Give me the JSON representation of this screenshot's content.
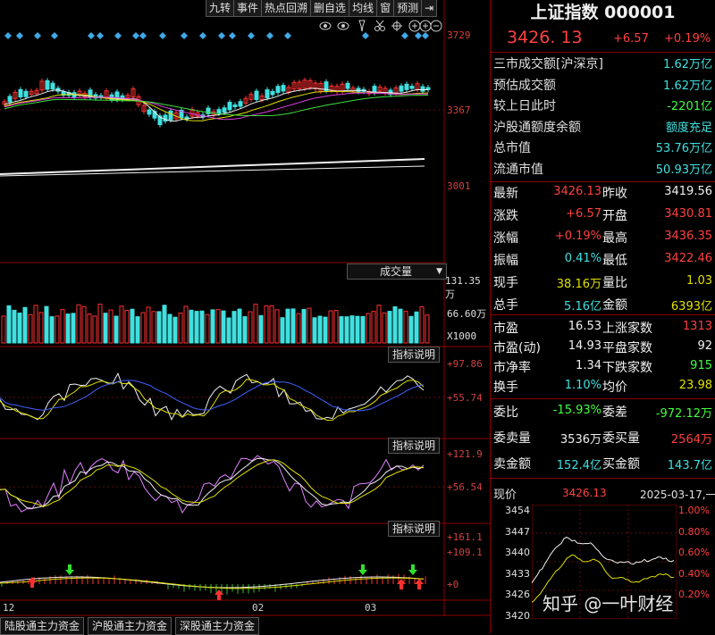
{
  "toolbar": [
    "九转",
    "事件",
    "热点回溯",
    "删自选",
    "均线",
    "窗",
    "预测"
  ],
  "toolbar_arrow": "⇥",
  "main_axis": {
    "top": "3729",
    "mid": "3367",
    "bottom": "3001"
  },
  "volume": {
    "selector": "成交量",
    "v1": "131.35万",
    "v2": "66.60万",
    "unit": "X1000"
  },
  "ind1": {
    "button": "指标说明",
    "top": "+97.86",
    "mid": "+55.74"
  },
  "ind2": {
    "button": "指标说明",
    "top": "+121.9",
    "mid": "+56.54"
  },
  "ind3": {
    "button": "指标说明",
    "top": "+161.1",
    "mid": "+109.1",
    "zero": "+0"
  },
  "x_labels": [
    "12",
    "02",
    "03"
  ],
  "bottom_tabs": [
    "陆股通主力资金",
    "沪股通主力资金",
    "深股通主力资金"
  ],
  "header": {
    "name": "上证指数",
    "code": "000001",
    "price": "3426. 13",
    "change": "+6.57",
    "pct": "+0.19%"
  },
  "info": [
    {
      "k": "三市成交额[沪深京]",
      "v": "1.62万亿",
      "c": "cyan"
    },
    {
      "k": "预估成交额",
      "v": "1.62万亿",
      "c": "cyan"
    },
    {
      "k": "较上日此时",
      "v": "-2201亿",
      "c": "green"
    },
    {
      "k": "沪股通额度余额",
      "v": "额度充足",
      "c": "cyan"
    },
    {
      "k": "总市值",
      "v": "53.76万亿",
      "c": "cyan"
    },
    {
      "k": "流通市值",
      "v": "50.93万亿",
      "c": "cyan"
    }
  ],
  "quotes": [
    {
      "k1": "最新",
      "v1": "3426.13",
      "c1": "red",
      "k2": "昨收",
      "v2": "3419.56",
      "c2": "white"
    },
    {
      "k1": "涨跌",
      "v1": "+6.57",
      "c1": "red",
      "k2": "开盘",
      "v2": "3430.81",
      "c2": "red"
    },
    {
      "k1": "涨幅",
      "v1": "+0.19%",
      "c1": "red",
      "k2": "最高",
      "v2": "3436.35",
      "c2": "red"
    },
    {
      "k1": "振幅",
      "v1": "0.41%",
      "c1": "cyan",
      "k2": "最低",
      "v2": "3422.46",
      "c2": "red"
    },
    {
      "k1": "现手",
      "v1": "38.16万",
      "c1": "yellow",
      "k2": "量比",
      "v2": "1.03",
      "c2": "yellow"
    },
    {
      "k1": "总手",
      "v1": "5.16亿",
      "c1": "cyan",
      "k2": "金额",
      "v2": "6393亿",
      "c2": "yellow"
    }
  ],
  "stats": [
    {
      "k1": "市盈",
      "v1": "16.53",
      "c1": "white",
      "k2": "上涨家数",
      "v2": "1313",
      "c2": "red"
    },
    {
      "k1": "市盈(动)",
      "v1": "14.93",
      "c1": "white",
      "k2": "平盘家数",
      "v2": "92",
      "c2": "white"
    },
    {
      "k1": "市净率",
      "v1": "1.34",
      "c1": "white",
      "k2": "下跌家数",
      "v2": "915",
      "c2": "green"
    },
    {
      "k1": "换手",
      "v1": "1.10%",
      "c1": "cyan",
      "k2": "均价",
      "v2": "23.98",
      "c2": "yellow"
    }
  ],
  "orders": [
    {
      "k1": "委比",
      "v1": "-15.93%",
      "c1": "green",
      "k2": "委差",
      "v2": "-972.12万",
      "c2": "green"
    },
    {
      "k1": "委卖量",
      "v1": "3536万",
      "c1": "white",
      "k2": "委买量",
      "v2": "2564万",
      "c2": "red"
    },
    {
      "k1": "卖金额",
      "v1": "152.4亿",
      "c1": "cyan",
      "k2": "买金额",
      "v2": "143.7亿",
      "c2": "cyan"
    }
  ],
  "mini": {
    "label": "现价",
    "price": "3426.13",
    "date": "2025-03-17,一",
    "left_ticks": [
      "3454",
      "3447",
      "3440",
      "3433",
      "3426",
      "3420"
    ],
    "right_ticks": [
      "1.00%",
      "0.80%",
      "0.60%",
      "0.40%",
      "0.20%",
      ""
    ]
  },
  "watermark": "知乎 @一叶财经"
}
